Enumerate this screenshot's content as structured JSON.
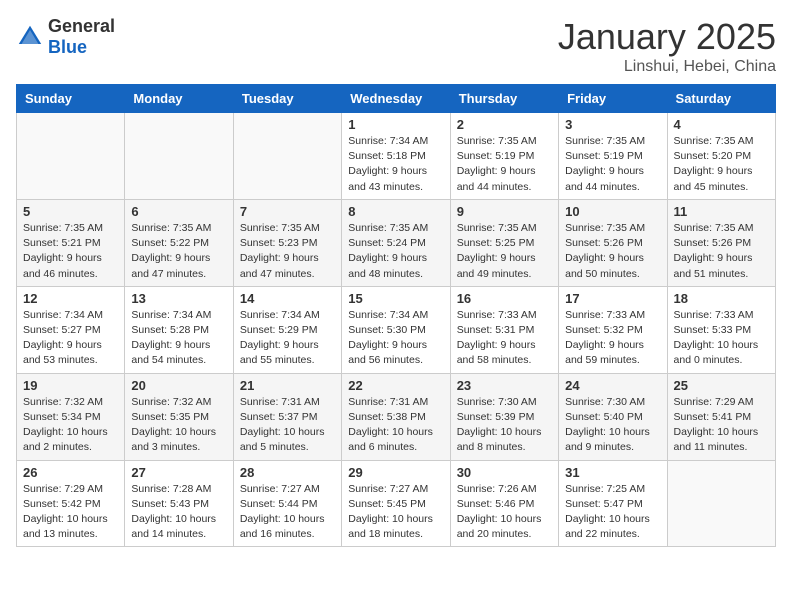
{
  "header": {
    "logo_general": "General",
    "logo_blue": "Blue",
    "title": "January 2025",
    "location": "Linshui, Hebei, China"
  },
  "days_of_week": [
    "Sunday",
    "Monday",
    "Tuesday",
    "Wednesday",
    "Thursday",
    "Friday",
    "Saturday"
  ],
  "weeks": [
    [
      {
        "day": "",
        "info": ""
      },
      {
        "day": "",
        "info": ""
      },
      {
        "day": "",
        "info": ""
      },
      {
        "day": "1",
        "info": "Sunrise: 7:34 AM\nSunset: 5:18 PM\nDaylight: 9 hours and 43 minutes."
      },
      {
        "day": "2",
        "info": "Sunrise: 7:35 AM\nSunset: 5:19 PM\nDaylight: 9 hours and 44 minutes."
      },
      {
        "day": "3",
        "info": "Sunrise: 7:35 AM\nSunset: 5:19 PM\nDaylight: 9 hours and 44 minutes."
      },
      {
        "day": "4",
        "info": "Sunrise: 7:35 AM\nSunset: 5:20 PM\nDaylight: 9 hours and 45 minutes."
      }
    ],
    [
      {
        "day": "5",
        "info": "Sunrise: 7:35 AM\nSunset: 5:21 PM\nDaylight: 9 hours and 46 minutes."
      },
      {
        "day": "6",
        "info": "Sunrise: 7:35 AM\nSunset: 5:22 PM\nDaylight: 9 hours and 47 minutes."
      },
      {
        "day": "7",
        "info": "Sunrise: 7:35 AM\nSunset: 5:23 PM\nDaylight: 9 hours and 47 minutes."
      },
      {
        "day": "8",
        "info": "Sunrise: 7:35 AM\nSunset: 5:24 PM\nDaylight: 9 hours and 48 minutes."
      },
      {
        "day": "9",
        "info": "Sunrise: 7:35 AM\nSunset: 5:25 PM\nDaylight: 9 hours and 49 minutes."
      },
      {
        "day": "10",
        "info": "Sunrise: 7:35 AM\nSunset: 5:26 PM\nDaylight: 9 hours and 50 minutes."
      },
      {
        "day": "11",
        "info": "Sunrise: 7:35 AM\nSunset: 5:26 PM\nDaylight: 9 hours and 51 minutes."
      }
    ],
    [
      {
        "day": "12",
        "info": "Sunrise: 7:34 AM\nSunset: 5:27 PM\nDaylight: 9 hours and 53 minutes."
      },
      {
        "day": "13",
        "info": "Sunrise: 7:34 AM\nSunset: 5:28 PM\nDaylight: 9 hours and 54 minutes."
      },
      {
        "day": "14",
        "info": "Sunrise: 7:34 AM\nSunset: 5:29 PM\nDaylight: 9 hours and 55 minutes."
      },
      {
        "day": "15",
        "info": "Sunrise: 7:34 AM\nSunset: 5:30 PM\nDaylight: 9 hours and 56 minutes."
      },
      {
        "day": "16",
        "info": "Sunrise: 7:33 AM\nSunset: 5:31 PM\nDaylight: 9 hours and 58 minutes."
      },
      {
        "day": "17",
        "info": "Sunrise: 7:33 AM\nSunset: 5:32 PM\nDaylight: 9 hours and 59 minutes."
      },
      {
        "day": "18",
        "info": "Sunrise: 7:33 AM\nSunset: 5:33 PM\nDaylight: 10 hours and 0 minutes."
      }
    ],
    [
      {
        "day": "19",
        "info": "Sunrise: 7:32 AM\nSunset: 5:34 PM\nDaylight: 10 hours and 2 minutes."
      },
      {
        "day": "20",
        "info": "Sunrise: 7:32 AM\nSunset: 5:35 PM\nDaylight: 10 hours and 3 minutes."
      },
      {
        "day": "21",
        "info": "Sunrise: 7:31 AM\nSunset: 5:37 PM\nDaylight: 10 hours and 5 minutes."
      },
      {
        "day": "22",
        "info": "Sunrise: 7:31 AM\nSunset: 5:38 PM\nDaylight: 10 hours and 6 minutes."
      },
      {
        "day": "23",
        "info": "Sunrise: 7:30 AM\nSunset: 5:39 PM\nDaylight: 10 hours and 8 minutes."
      },
      {
        "day": "24",
        "info": "Sunrise: 7:30 AM\nSunset: 5:40 PM\nDaylight: 10 hours and 9 minutes."
      },
      {
        "day": "25",
        "info": "Sunrise: 7:29 AM\nSunset: 5:41 PM\nDaylight: 10 hours and 11 minutes."
      }
    ],
    [
      {
        "day": "26",
        "info": "Sunrise: 7:29 AM\nSunset: 5:42 PM\nDaylight: 10 hours and 13 minutes."
      },
      {
        "day": "27",
        "info": "Sunrise: 7:28 AM\nSunset: 5:43 PM\nDaylight: 10 hours and 14 minutes."
      },
      {
        "day": "28",
        "info": "Sunrise: 7:27 AM\nSunset: 5:44 PM\nDaylight: 10 hours and 16 minutes."
      },
      {
        "day": "29",
        "info": "Sunrise: 7:27 AM\nSunset: 5:45 PM\nDaylight: 10 hours and 18 minutes."
      },
      {
        "day": "30",
        "info": "Sunrise: 7:26 AM\nSunset: 5:46 PM\nDaylight: 10 hours and 20 minutes."
      },
      {
        "day": "31",
        "info": "Sunrise: 7:25 AM\nSunset: 5:47 PM\nDaylight: 10 hours and 22 minutes."
      },
      {
        "day": "",
        "info": ""
      }
    ]
  ]
}
